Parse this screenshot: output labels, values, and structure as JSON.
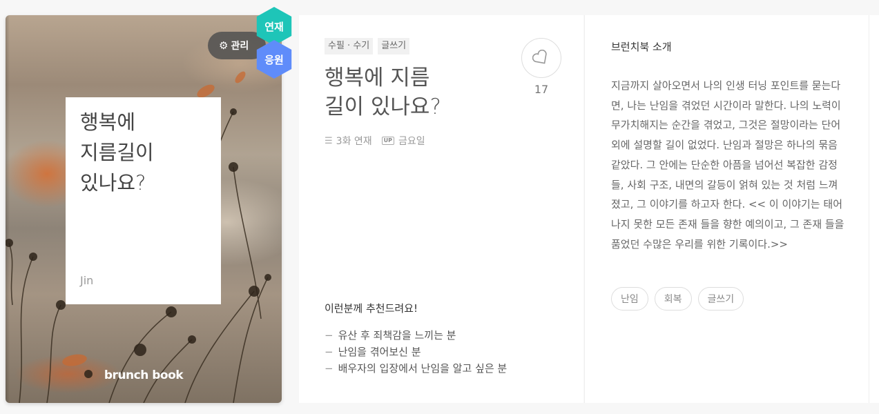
{
  "cover": {
    "title": "행복에\n지름길이\n있나요?",
    "author": "Jin",
    "brand": "brunch book",
    "manage_label": "관리",
    "serial_badge": "연재",
    "support_badge": "응원"
  },
  "info": {
    "tags": [
      "수필 · 수기",
      "글쓰기"
    ],
    "title": "행복에 지름\n길이 있나요?",
    "episodes": "3화 연재",
    "schedule_icon": "UP",
    "schedule": "금요일",
    "like_count": "17",
    "recommend_title": "이런분께 추천드려요!",
    "recommend_items": [
      "유산 후 죄책감을 느끼는 분",
      "난임을 겪어보신 분",
      "배우자의 입장에서 난임을 알고 싶은 분"
    ]
  },
  "intro": {
    "heading": "브런치북 소개",
    "text": "지금까지 살아오면서 나의 인생 터닝 포인트를 묻는다면, 나는 난임을 겪었던 시간이라 말한다. 나의 노력이 무가치해지는 순간을 겪었고, 그것은 절망이라는 단어 외에 설명할 길이 없었다. 난임과 절망은 하나의 묶음 같았다. 그 안에는 단순한 아픔을 넘어선 복잡한 감정들, 사회 구조, 내면의 갈등이 얽혀 있는 것 처럼 느껴졌고, 그 이야기를 하고자 한다. << 이 이야기는 태어나지 못한 모든 존재 들을 향한 예의이고, 그 존재 들을 품었던 수많은 우리를 위한 기록이다.>>",
    "keywords": [
      "난임",
      "회복",
      "글쓰기"
    ]
  },
  "icons": {
    "manage": "gear-icon",
    "like": "heart-icon",
    "episodes": "list-icon",
    "schedule": "up-calendar-icon"
  },
  "colors": {
    "serial_badge": "#1ec5b8",
    "support_badge": "#5f8cfa"
  }
}
